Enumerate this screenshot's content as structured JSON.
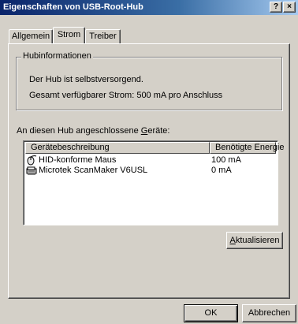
{
  "window": {
    "title": "Eigenschaften von USB-Root-Hub",
    "help_label": "?",
    "close_label": "×"
  },
  "tabs": [
    {
      "label": "Allgemein",
      "active": false
    },
    {
      "label": "Strom",
      "active": true
    },
    {
      "label": "Treiber",
      "active": false
    }
  ],
  "hubinfo": {
    "group_label": "Hubinformationen",
    "line1": "Der Hub ist selbstversorgend.",
    "line2": "Gesamt verfügbarer Strom: 500 mA pro Anschluss"
  },
  "devices": {
    "label_prefix": "An diesen Hub angeschlossene ",
    "label_accel": "G",
    "label_suffix": "eräte:",
    "columns": [
      "Gerätebeschreibung",
      "Benötigte Energie"
    ],
    "rows": [
      {
        "name": "HID-konforme Maus",
        "energy": "100 mA",
        "icon": "mouse-icon"
      },
      {
        "name": "Microtek ScanMaker V6USL",
        "energy": "0 mA",
        "icon": "scanner-icon"
      }
    ]
  },
  "buttons": {
    "refresh_accel": "A",
    "refresh_rest": "ktualisieren",
    "ok": "OK",
    "cancel": "Abbrechen"
  }
}
